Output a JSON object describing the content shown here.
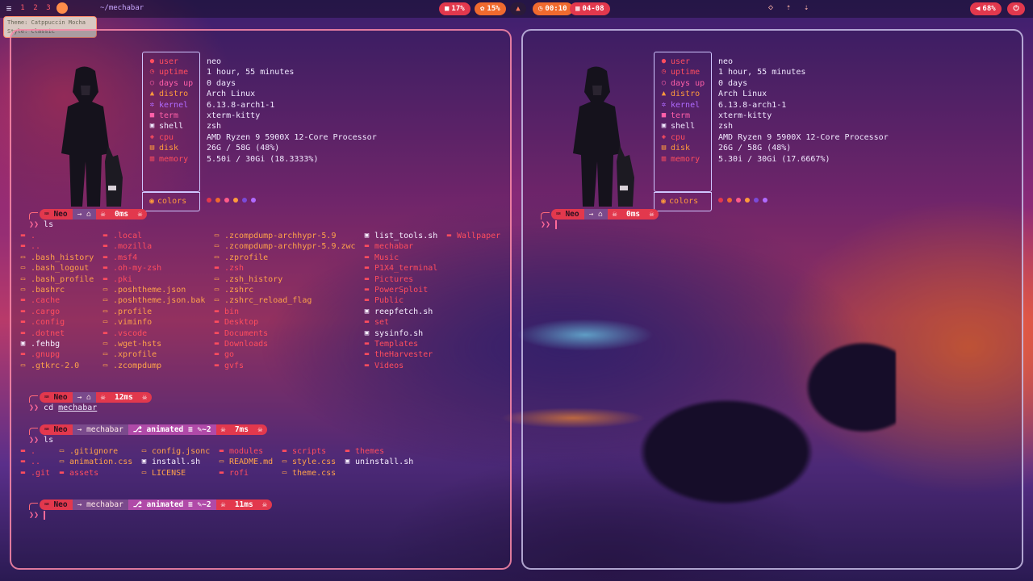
{
  "topbar": {
    "workspaces": [
      "1",
      "2",
      "3"
    ],
    "path": "~/mechabar",
    "cpu": "17%",
    "memory": "15%",
    "time": "00:10",
    "date": "04-08",
    "volume": "68%",
    "tooltip_line1": "Theme: Catppuccin Mocha",
    "tooltip_line2": "Style: Classic"
  },
  "fetch": {
    "rows": [
      {
        "key": "user",
        "icon": "user-icon",
        "value": "neo"
      },
      {
        "key": "uptime",
        "icon": "clock-icon",
        "value": "1 hour, 55 minutes"
      },
      {
        "key": "days up",
        "icon": "circle-icon",
        "value": "0 days"
      },
      {
        "key": "distro",
        "icon": "arch-icon",
        "value": "Arch Linux"
      },
      {
        "key": "kernel",
        "icon": "gear-icon",
        "value": "6.13.8-arch1-1"
      },
      {
        "key": "term",
        "icon": "terminal-icon",
        "value": "xterm-kitty"
      },
      {
        "key": "shell",
        "icon": "shell-icon",
        "value": "zsh"
      },
      {
        "key": "cpu",
        "icon": "cpu-icon",
        "value": "AMD Ryzen 9 5900X 12-Core Processor"
      },
      {
        "key": "disk",
        "icon": "disk-icon",
        "value": "26G / 58G (48%)"
      },
      {
        "key": "memory",
        "icon": "memory-icon",
        "value": "5.50i / 30Gi (18.3333%)"
      }
    ],
    "colors_label": "colors",
    "palette": [
      "#e2384d",
      "#f06a2e",
      "#ff5a8a",
      "#ff9a3c",
      "#7a4ad8",
      "#b06aff"
    ]
  },
  "fetch_right_values": {
    "memory": "5.30i / 30Gi (17.6667%)"
  },
  "prompt": {
    "user": "Neo",
    "home_segment": "→ ⌂",
    "mechabar_dir": "mechabar",
    "git_branch": "animated",
    "git_status": "≡ ✎~2",
    "skull": "☠"
  },
  "session_left": {
    "ls1_time": "0ms",
    "ls1_cmd": "ls",
    "cd_time": "12ms",
    "cd_cmd": "cd",
    "cd_arg": "mechabar",
    "ls2_time": "7ms",
    "ls2_cmd": "ls",
    "last_time": "11ms"
  },
  "session_right": {
    "time": "0ms"
  },
  "listing_home": [
    [
      {
        "name": ".",
        "type": "dir"
      },
      {
        "name": "..",
        "type": "dir"
      },
      {
        "name": ".bash_history",
        "type": "file"
      },
      {
        "name": ".bash_logout",
        "type": "file"
      },
      {
        "name": ".bash_profile",
        "type": "file"
      },
      {
        "name": ".bashrc",
        "type": "file"
      },
      {
        "name": ".cache",
        "type": "dir"
      },
      {
        "name": ".cargo",
        "type": "dir"
      },
      {
        "name": ".config",
        "type": "dir"
      },
      {
        "name": ".dotnet",
        "type": "dir"
      },
      {
        "name": ".fehbg",
        "type": "exec"
      },
      {
        "name": ".gnupg",
        "type": "dir"
      },
      {
        "name": ".gtkrc-2.0",
        "type": "file"
      }
    ],
    [
      {
        "name": ".local",
        "type": "dir"
      },
      {
        "name": ".mozilla",
        "type": "dir"
      },
      {
        "name": ".msf4",
        "type": "dir"
      },
      {
        "name": ".oh-my-zsh",
        "type": "dir"
      },
      {
        "name": ".pki",
        "type": "dir"
      },
      {
        "name": ".poshtheme.json",
        "type": "file"
      },
      {
        "name": ".poshtheme.json.bak",
        "type": "file"
      },
      {
        "name": ".profile",
        "type": "file"
      },
      {
        "name": ".viminfo",
        "type": "file"
      },
      {
        "name": ".vscode",
        "type": "dir"
      },
      {
        "name": ".wget-hsts",
        "type": "file"
      },
      {
        "name": ".xprofile",
        "type": "file"
      },
      {
        "name": ".zcompdump",
        "type": "file"
      }
    ],
    [
      {
        "name": ".zcompdump-archhypr-5.9",
        "type": "file"
      },
      {
        "name": ".zcompdump-archhypr-5.9.zwc",
        "type": "file"
      },
      {
        "name": ".zprofile",
        "type": "file"
      },
      {
        "name": ".zsh",
        "type": "dir"
      },
      {
        "name": ".zsh_history",
        "type": "file"
      },
      {
        "name": ".zshrc",
        "type": "file"
      },
      {
        "name": ".zshrc_reload_flag",
        "type": "file"
      },
      {
        "name": "bin",
        "type": "dir"
      },
      {
        "name": "Desktop",
        "type": "dir"
      },
      {
        "name": "Documents",
        "type": "dir"
      },
      {
        "name": "Downloads",
        "type": "dir"
      },
      {
        "name": "go",
        "type": "dir"
      },
      {
        "name": "gvfs",
        "type": "dir"
      }
    ],
    [
      {
        "name": "list_tools.sh",
        "type": "exec"
      },
      {
        "name": "mechabar",
        "type": "dir"
      },
      {
        "name": "Music",
        "type": "dir"
      },
      {
        "name": "P1X4_terminal",
        "type": "dir"
      },
      {
        "name": "Pictures",
        "type": "dir"
      },
      {
        "name": "PowerSploit",
        "type": "dir"
      },
      {
        "name": "Public",
        "type": "dir"
      },
      {
        "name": "reepfetch.sh",
        "type": "exec"
      },
      {
        "name": "set",
        "type": "dir"
      },
      {
        "name": "sysinfo.sh",
        "type": "exec"
      },
      {
        "name": "Templates",
        "type": "dir"
      },
      {
        "name": "theHarvester",
        "type": "dir"
      },
      {
        "name": "Videos",
        "type": "dir"
      }
    ],
    [
      {
        "name": "Wallpaper",
        "type": "dir"
      }
    ]
  ],
  "listing_mechabar": [
    [
      {
        "name": ".",
        "type": "dir"
      },
      {
        "name": "..",
        "type": "dir"
      },
      {
        "name": ".git",
        "type": "dir"
      }
    ],
    [
      {
        "name": ".gitignore",
        "type": "file"
      },
      {
        "name": "animation.css",
        "type": "file"
      },
      {
        "name": "assets",
        "type": "dir"
      }
    ],
    [
      {
        "name": "config.jsonc",
        "type": "file"
      },
      {
        "name": "install.sh",
        "type": "exec"
      },
      {
        "name": "LICENSE",
        "type": "file"
      }
    ],
    [
      {
        "name": "modules",
        "type": "dir"
      },
      {
        "name": "README.md",
        "type": "file"
      },
      {
        "name": "rofi",
        "type": "dir"
      }
    ],
    [
      {
        "name": "scripts",
        "type": "dir"
      },
      {
        "name": "style.css",
        "type": "file"
      },
      {
        "name": "theme.css",
        "type": "file"
      }
    ],
    [
      {
        "name": "themes",
        "type": "dir"
      },
      {
        "name": "uninstall.sh",
        "type": "exec"
      }
    ]
  ]
}
